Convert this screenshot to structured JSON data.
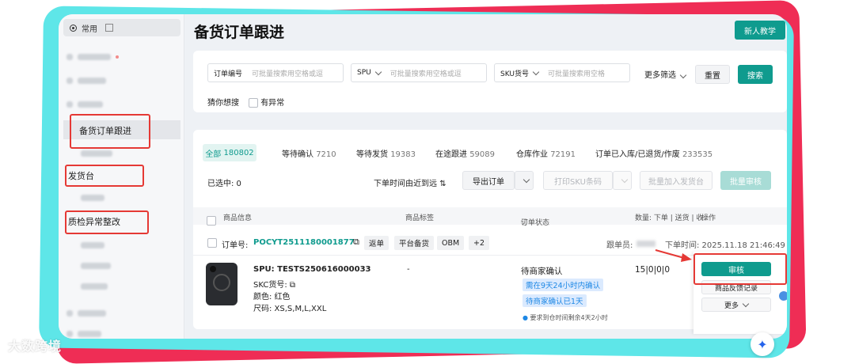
{
  "page": {
    "title": "备货订单跟进",
    "new_user_tutorial": "新人教学"
  },
  "sidebar": {
    "common": "常用",
    "items": [
      "备货订单跟进",
      "发货台",
      "质检异常整改"
    ]
  },
  "filters": {
    "order_no": {
      "label": "订单编号",
      "placeholder": "可批量搜索用空格或逗"
    },
    "spu": {
      "label": "SPU",
      "placeholder": "可批量搜索用空格或逗"
    },
    "sku": {
      "label": "SKU货号",
      "placeholder": "可批量搜索用空格"
    },
    "more": "更多筛选",
    "reset": "重置",
    "search": "搜索",
    "guess": "猜你想搜",
    "abnormal": "有异常"
  },
  "tabs": [
    {
      "label": "全部",
      "count": "180802"
    },
    {
      "label": "等待确认",
      "count": "7210"
    },
    {
      "label": "等待发货",
      "count": "19383"
    },
    {
      "label": "在途跟进",
      "count": "59089"
    },
    {
      "label": "仓库作业",
      "count": "72191"
    },
    {
      "label": "订单已入库/已退货/作废",
      "count": "233535"
    }
  ],
  "toolbar": {
    "selected": "已选中: 0",
    "sort": "下单时间由近到远",
    "export": "导出订单",
    "print_sku": "打印SKU条码",
    "batch_add": "批量加入发货台",
    "batch_review": "批量审核"
  },
  "table_head": {
    "product_info": "商品信息",
    "product_tags": "商品标签",
    "order_status": "订单状态",
    "quantity": "数量: 下单 | 送货 | 收",
    "operation": "操作"
  },
  "order": {
    "order_label": "订单号:",
    "order_no": "POCYT2511180001877",
    "tags": [
      "返单",
      "平台备货",
      "OBM",
      "+2"
    ],
    "follower_label": "跟单员:",
    "time": "下单时间: 2025.11.18 21:46:49",
    "spu": "SPU: TESTS250616000033",
    "skc": "SKC货号:",
    "color": "颜色: 红色",
    "size": "尺码: XS,S,M,L,XXL",
    "tag_value": "-",
    "status": "待商家确认",
    "status_pill_1": "需在9天24小时内确认",
    "status_pill_2": "待商家确认已1天",
    "deadline_note": "要求到仓时间剩余4天2小时",
    "qty": "15|0|0|0",
    "review": "审核",
    "feedback": "商品反馈记录",
    "more": "更多"
  },
  "watermark": "大数跨境"
}
